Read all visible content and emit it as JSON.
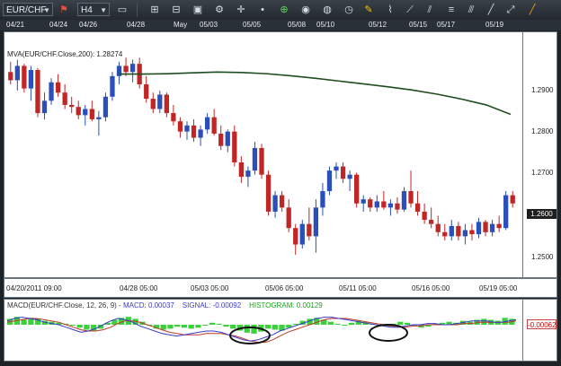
{
  "toolbar": {
    "symbol": "EUR/CHF",
    "timeframe": "H4",
    "colors": {
      "bg": "#2a3037"
    }
  },
  "top_dates": [
    "04/21",
    "04/24",
    "04/26",
    "04/28",
    "May",
    "05/03",
    "05/05",
    "05/08",
    "05/10",
    "05/12",
    "05/15",
    "05/17",
    "05/19"
  ],
  "indicator_label": "MVA(EUR/CHF.Close,200): 1.28274",
  "price_axis": [
    "1.2900",
    "1.2800",
    "1.2700",
    "1.2600",
    "1.2500"
  ],
  "current_price": "1.2600",
  "x_axis": [
    "04/20/2011 09:00",
    "04/28 05:00",
    "05/03 05:00",
    "05/06 05:00",
    "05/11 05:00",
    "05/16 05:00",
    "05/19 05:00"
  ],
  "macd": {
    "label_prefix": "MACD(EUR/CHF.Close, 12, 26, 9)",
    "macd_text": "MACD: 0.00037",
    "signal_text": "SIGNAL: -0.00092",
    "histogram_text": "HISTOGRAM: 0.00129",
    "current_value": "-0.00062",
    "colors": {
      "macd": "#3a3acc",
      "signal": "#c0392b",
      "histogram": "#3bd13b"
    }
  },
  "chart_data": {
    "type": "candlestick",
    "symbol": "EUR/CHF",
    "timeframe": "H4",
    "ylim": [
      1.245,
      1.297
    ],
    "candles": [
      {
        "o": 1.293,
        "h": 1.2955,
        "l": 1.29,
        "c": 1.291
      },
      {
        "o": 1.291,
        "h": 1.296,
        "l": 1.2885,
        "c": 1.2945
      },
      {
        "o": 1.2945,
        "h": 1.295,
        "l": 1.288,
        "c": 1.289
      },
      {
        "o": 1.289,
        "h": 1.2945,
        "l": 1.286,
        "c": 1.2935
      },
      {
        "o": 1.2935,
        "h": 1.294,
        "l": 1.282,
        "c": 1.283
      },
      {
        "o": 1.283,
        "h": 1.288,
        "l": 1.2815,
        "c": 1.286
      },
      {
        "o": 1.286,
        "h": 1.2915,
        "l": 1.285,
        "c": 1.2905
      },
      {
        "o": 1.2905,
        "h": 1.2925,
        "l": 1.287,
        "c": 1.288
      },
      {
        "o": 1.288,
        "h": 1.29,
        "l": 1.284,
        "c": 1.285
      },
      {
        "o": 1.285,
        "h": 1.287,
        "l": 1.283,
        "c": 1.2845
      },
      {
        "o": 1.2845,
        "h": 1.286,
        "l": 1.2815,
        "c": 1.2825
      },
      {
        "o": 1.2825,
        "h": 1.285,
        "l": 1.28,
        "c": 1.284
      },
      {
        "o": 1.284,
        "h": 1.286,
        "l": 1.281,
        "c": 1.2815
      },
      {
        "o": 1.2815,
        "h": 1.2835,
        "l": 1.2775,
        "c": 1.282
      },
      {
        "o": 1.282,
        "h": 1.288,
        "l": 1.281,
        "c": 1.287
      },
      {
        "o": 1.287,
        "h": 1.293,
        "l": 1.286,
        "c": 1.292
      },
      {
        "o": 1.292,
        "h": 1.2955,
        "l": 1.29,
        "c": 1.2945
      },
      {
        "o": 1.2945,
        "h": 1.2965,
        "l": 1.292,
        "c": 1.293
      },
      {
        "o": 1.293,
        "h": 1.296,
        "l": 1.2905,
        "c": 1.295
      },
      {
        "o": 1.295,
        "h": 1.2965,
        "l": 1.289,
        "c": 1.29
      },
      {
        "o": 1.29,
        "h": 1.292,
        "l": 1.2855,
        "c": 1.2865
      },
      {
        "o": 1.2865,
        "h": 1.288,
        "l": 1.283,
        "c": 1.284
      },
      {
        "o": 1.284,
        "h": 1.2885,
        "l": 1.283,
        "c": 1.2875
      },
      {
        "o": 1.2875,
        "h": 1.288,
        "l": 1.282,
        "c": 1.283
      },
      {
        "o": 1.283,
        "h": 1.285,
        "l": 1.28,
        "c": 1.281
      },
      {
        "o": 1.281,
        "h": 1.282,
        "l": 1.277,
        "c": 1.2785
      },
      {
        "o": 1.2785,
        "h": 1.281,
        "l": 1.2765,
        "c": 1.28
      },
      {
        "o": 1.28,
        "h": 1.2815,
        "l": 1.276,
        "c": 1.277
      },
      {
        "o": 1.277,
        "h": 1.28,
        "l": 1.275,
        "c": 1.279
      },
      {
        "o": 1.279,
        "h": 1.283,
        "l": 1.278,
        "c": 1.282
      },
      {
        "o": 1.282,
        "h": 1.284,
        "l": 1.2775,
        "c": 1.278
      },
      {
        "o": 1.278,
        "h": 1.28,
        "l": 1.274,
        "c": 1.275
      },
      {
        "o": 1.275,
        "h": 1.279,
        "l": 1.2735,
        "c": 1.2785
      },
      {
        "o": 1.2785,
        "h": 1.28,
        "l": 1.27,
        "c": 1.271
      },
      {
        "o": 1.271,
        "h": 1.2725,
        "l": 1.266,
        "c": 1.2675
      },
      {
        "o": 1.2675,
        "h": 1.27,
        "l": 1.265,
        "c": 1.269
      },
      {
        "o": 1.269,
        "h": 1.276,
        "l": 1.268,
        "c": 1.2745
      },
      {
        "o": 1.2745,
        "h": 1.2755,
        "l": 1.267,
        "c": 1.268
      },
      {
        "o": 1.268,
        "h": 1.269,
        "l": 1.258,
        "c": 1.259
      },
      {
        "o": 1.259,
        "h": 1.264,
        "l": 1.2575,
        "c": 1.263
      },
      {
        "o": 1.263,
        "h": 1.264,
        "l": 1.259,
        "c": 1.26
      },
      {
        "o": 1.26,
        "h": 1.262,
        "l": 1.254,
        "c": 1.255
      },
      {
        "o": 1.255,
        "h": 1.256,
        "l": 1.2485,
        "c": 1.251
      },
      {
        "o": 1.251,
        "h": 1.257,
        "l": 1.25,
        "c": 1.256
      },
      {
        "o": 1.256,
        "h": 1.26,
        "l": 1.252,
        "c": 1.253
      },
      {
        "o": 1.253,
        "h": 1.262,
        "l": 1.249,
        "c": 1.26
      },
      {
        "o": 1.26,
        "h": 1.266,
        "l": 1.258,
        "c": 1.264
      },
      {
        "o": 1.264,
        "h": 1.27,
        "l": 1.263,
        "c": 1.269
      },
      {
        "o": 1.269,
        "h": 1.271,
        "l": 1.267,
        "c": 1.27
      },
      {
        "o": 1.27,
        "h": 1.271,
        "l": 1.266,
        "c": 1.267
      },
      {
        "o": 1.267,
        "h": 1.269,
        "l": 1.264,
        "c": 1.268
      },
      {
        "o": 1.268,
        "h": 1.2685,
        "l": 1.26,
        "c": 1.261
      },
      {
        "o": 1.261,
        "h": 1.263,
        "l": 1.259,
        "c": 1.262
      },
      {
        "o": 1.262,
        "h": 1.2625,
        "l": 1.259,
        "c": 1.26
      },
      {
        "o": 1.26,
        "h": 1.263,
        "l": 1.259,
        "c": 1.2615
      },
      {
        "o": 1.2615,
        "h": 1.264,
        "l": 1.2595,
        "c": 1.26
      },
      {
        "o": 1.26,
        "h": 1.262,
        "l": 1.258,
        "c": 1.261
      },
      {
        "o": 1.261,
        "h": 1.2625,
        "l": 1.2585,
        "c": 1.2595
      },
      {
        "o": 1.2595,
        "h": 1.265,
        "l": 1.259,
        "c": 1.264
      },
      {
        "o": 1.264,
        "h": 1.269,
        "l": 1.26,
        "c": 1.261
      },
      {
        "o": 1.261,
        "h": 1.264,
        "l": 1.258,
        "c": 1.259
      },
      {
        "o": 1.259,
        "h": 1.261,
        "l": 1.256,
        "c": 1.257
      },
      {
        "o": 1.257,
        "h": 1.26,
        "l": 1.255,
        "c": 1.256
      },
      {
        "o": 1.256,
        "h": 1.258,
        "l": 1.253,
        "c": 1.254
      },
      {
        "o": 1.254,
        "h": 1.256,
        "l": 1.252,
        "c": 1.253
      },
      {
        "o": 1.253,
        "h": 1.257,
        "l": 1.252,
        "c": 1.2555
      },
      {
        "o": 1.2555,
        "h": 1.2565,
        "l": 1.252,
        "c": 1.253
      },
      {
        "o": 1.253,
        "h": 1.256,
        "l": 1.251,
        "c": 1.2545
      },
      {
        "o": 1.2545,
        "h": 1.256,
        "l": 1.252,
        "c": 1.2535
      },
      {
        "o": 1.2535,
        "h": 1.2575,
        "l": 1.2525,
        "c": 1.2565
      },
      {
        "o": 1.2565,
        "h": 1.257,
        "l": 1.253,
        "c": 1.254
      },
      {
        "o": 1.254,
        "h": 1.257,
        "l": 1.253,
        "c": 1.256
      },
      {
        "o": 1.256,
        "h": 1.258,
        "l": 1.254,
        "c": 1.255
      },
      {
        "o": 1.255,
        "h": 1.264,
        "l": 1.2545,
        "c": 1.263
      },
      {
        "o": 1.263,
        "h": 1.264,
        "l": 1.26,
        "c": 1.261
      }
    ],
    "mva_200": {
      "name": "MVA(EUR/CHF.Close,200)",
      "x_start": 0.22,
      "values": [
        1.2925,
        1.2925,
        1.2926,
        1.2928,
        1.293,
        1.2929,
        1.2926,
        1.2921,
        1.2915,
        1.2908,
        1.2901,
        1.2894,
        1.2886,
        1.2876,
        1.2864,
        1.285,
        1.2827
      ]
    },
    "macd_series": {
      "histogram": [
        0.6,
        0.8,
        0.5,
        0.7,
        0.6,
        0.4,
        0.3,
        0.2,
        0.1,
        -0.1,
        -0.3,
        -0.5,
        -0.6,
        -0.4,
        0.2,
        0.5,
        0.7,
        0.8,
        0.6,
        0.3,
        -0.1,
        -0.4,
        -0.5,
        -0.4,
        -0.2,
        -0.3,
        -0.4,
        -0.3,
        -0.1,
        0.2,
        0.1,
        -0.2,
        -0.4,
        -0.6,
        -0.8,
        -0.9,
        -0.7,
        -0.4,
        -0.5,
        -0.6,
        -0.3,
        0.1,
        0.4,
        0.6,
        0.7,
        0.5,
        0.3,
        0.1,
        -0.1,
        0.2,
        0.4,
        0.3,
        0.1,
        -0.1,
        -0.2,
        0.1,
        0.3,
        0.2,
        -0.1,
        -0.3,
        -0.2,
        0.1,
        0.2,
        0.3,
        0.2,
        0.4,
        0.3,
        0.5,
        0.6,
        0.5,
        0.4,
        0.7,
        0.6
      ],
      "macd_line": [
        0.3,
        0.5,
        0.6,
        0.5,
        0.4,
        0.2,
        0.1,
        0.0,
        -0.2,
        -0.4,
        -0.6,
        -0.5,
        -0.3,
        0.0,
        0.3,
        0.5,
        0.4,
        0.2,
        -0.1,
        -0.3,
        -0.5,
        -0.7,
        -0.8,
        -0.9,
        -0.8,
        -0.7,
        -0.6,
        -0.5,
        -0.5,
        -0.6,
        -0.8,
        -1.0,
        -1.2,
        -1.3,
        -1.2,
        -1.0,
        -0.8,
        -0.5,
        -0.3,
        -0.1,
        0.1,
        0.3,
        0.5,
        0.6,
        0.6,
        0.5,
        0.4,
        0.3,
        0.2,
        0.1,
        0.0,
        -0.1,
        -0.2,
        -0.2,
        -0.1,
        0.0,
        0.0,
        0.1,
        0.1,
        0.0,
        0.0,
        0.1,
        0.2,
        0.3,
        0.3,
        0.3,
        0.2,
        0.2,
        0.3,
        0.4
      ],
      "signal_line": [
        0.2,
        0.3,
        0.4,
        0.5,
        0.5,
        0.4,
        0.3,
        0.2,
        0.0,
        -0.2,
        -0.4,
        -0.5,
        -0.5,
        -0.4,
        -0.2,
        0.1,
        0.3,
        0.3,
        0.2,
        0.0,
        -0.2,
        -0.4,
        -0.6,
        -0.7,
        -0.8,
        -0.8,
        -0.8,
        -0.7,
        -0.7,
        -0.7,
        -0.8,
        -0.9,
        -1.1,
        -1.3,
        -1.4,
        -1.4,
        -1.2,
        -0.9,
        -0.6,
        -0.4,
        -0.2,
        0.0,
        0.2,
        0.4,
        0.5,
        0.5,
        0.5,
        0.4,
        0.3,
        0.2,
        0.1,
        0.0,
        -0.1,
        -0.2,
        -0.2,
        -0.1,
        -0.1,
        0.0,
        0.0,
        0.0,
        0.0,
        0.0,
        0.1,
        0.1,
        0.2,
        0.2,
        0.2,
        0.2,
        0.2,
        0.3
      ]
    }
  }
}
